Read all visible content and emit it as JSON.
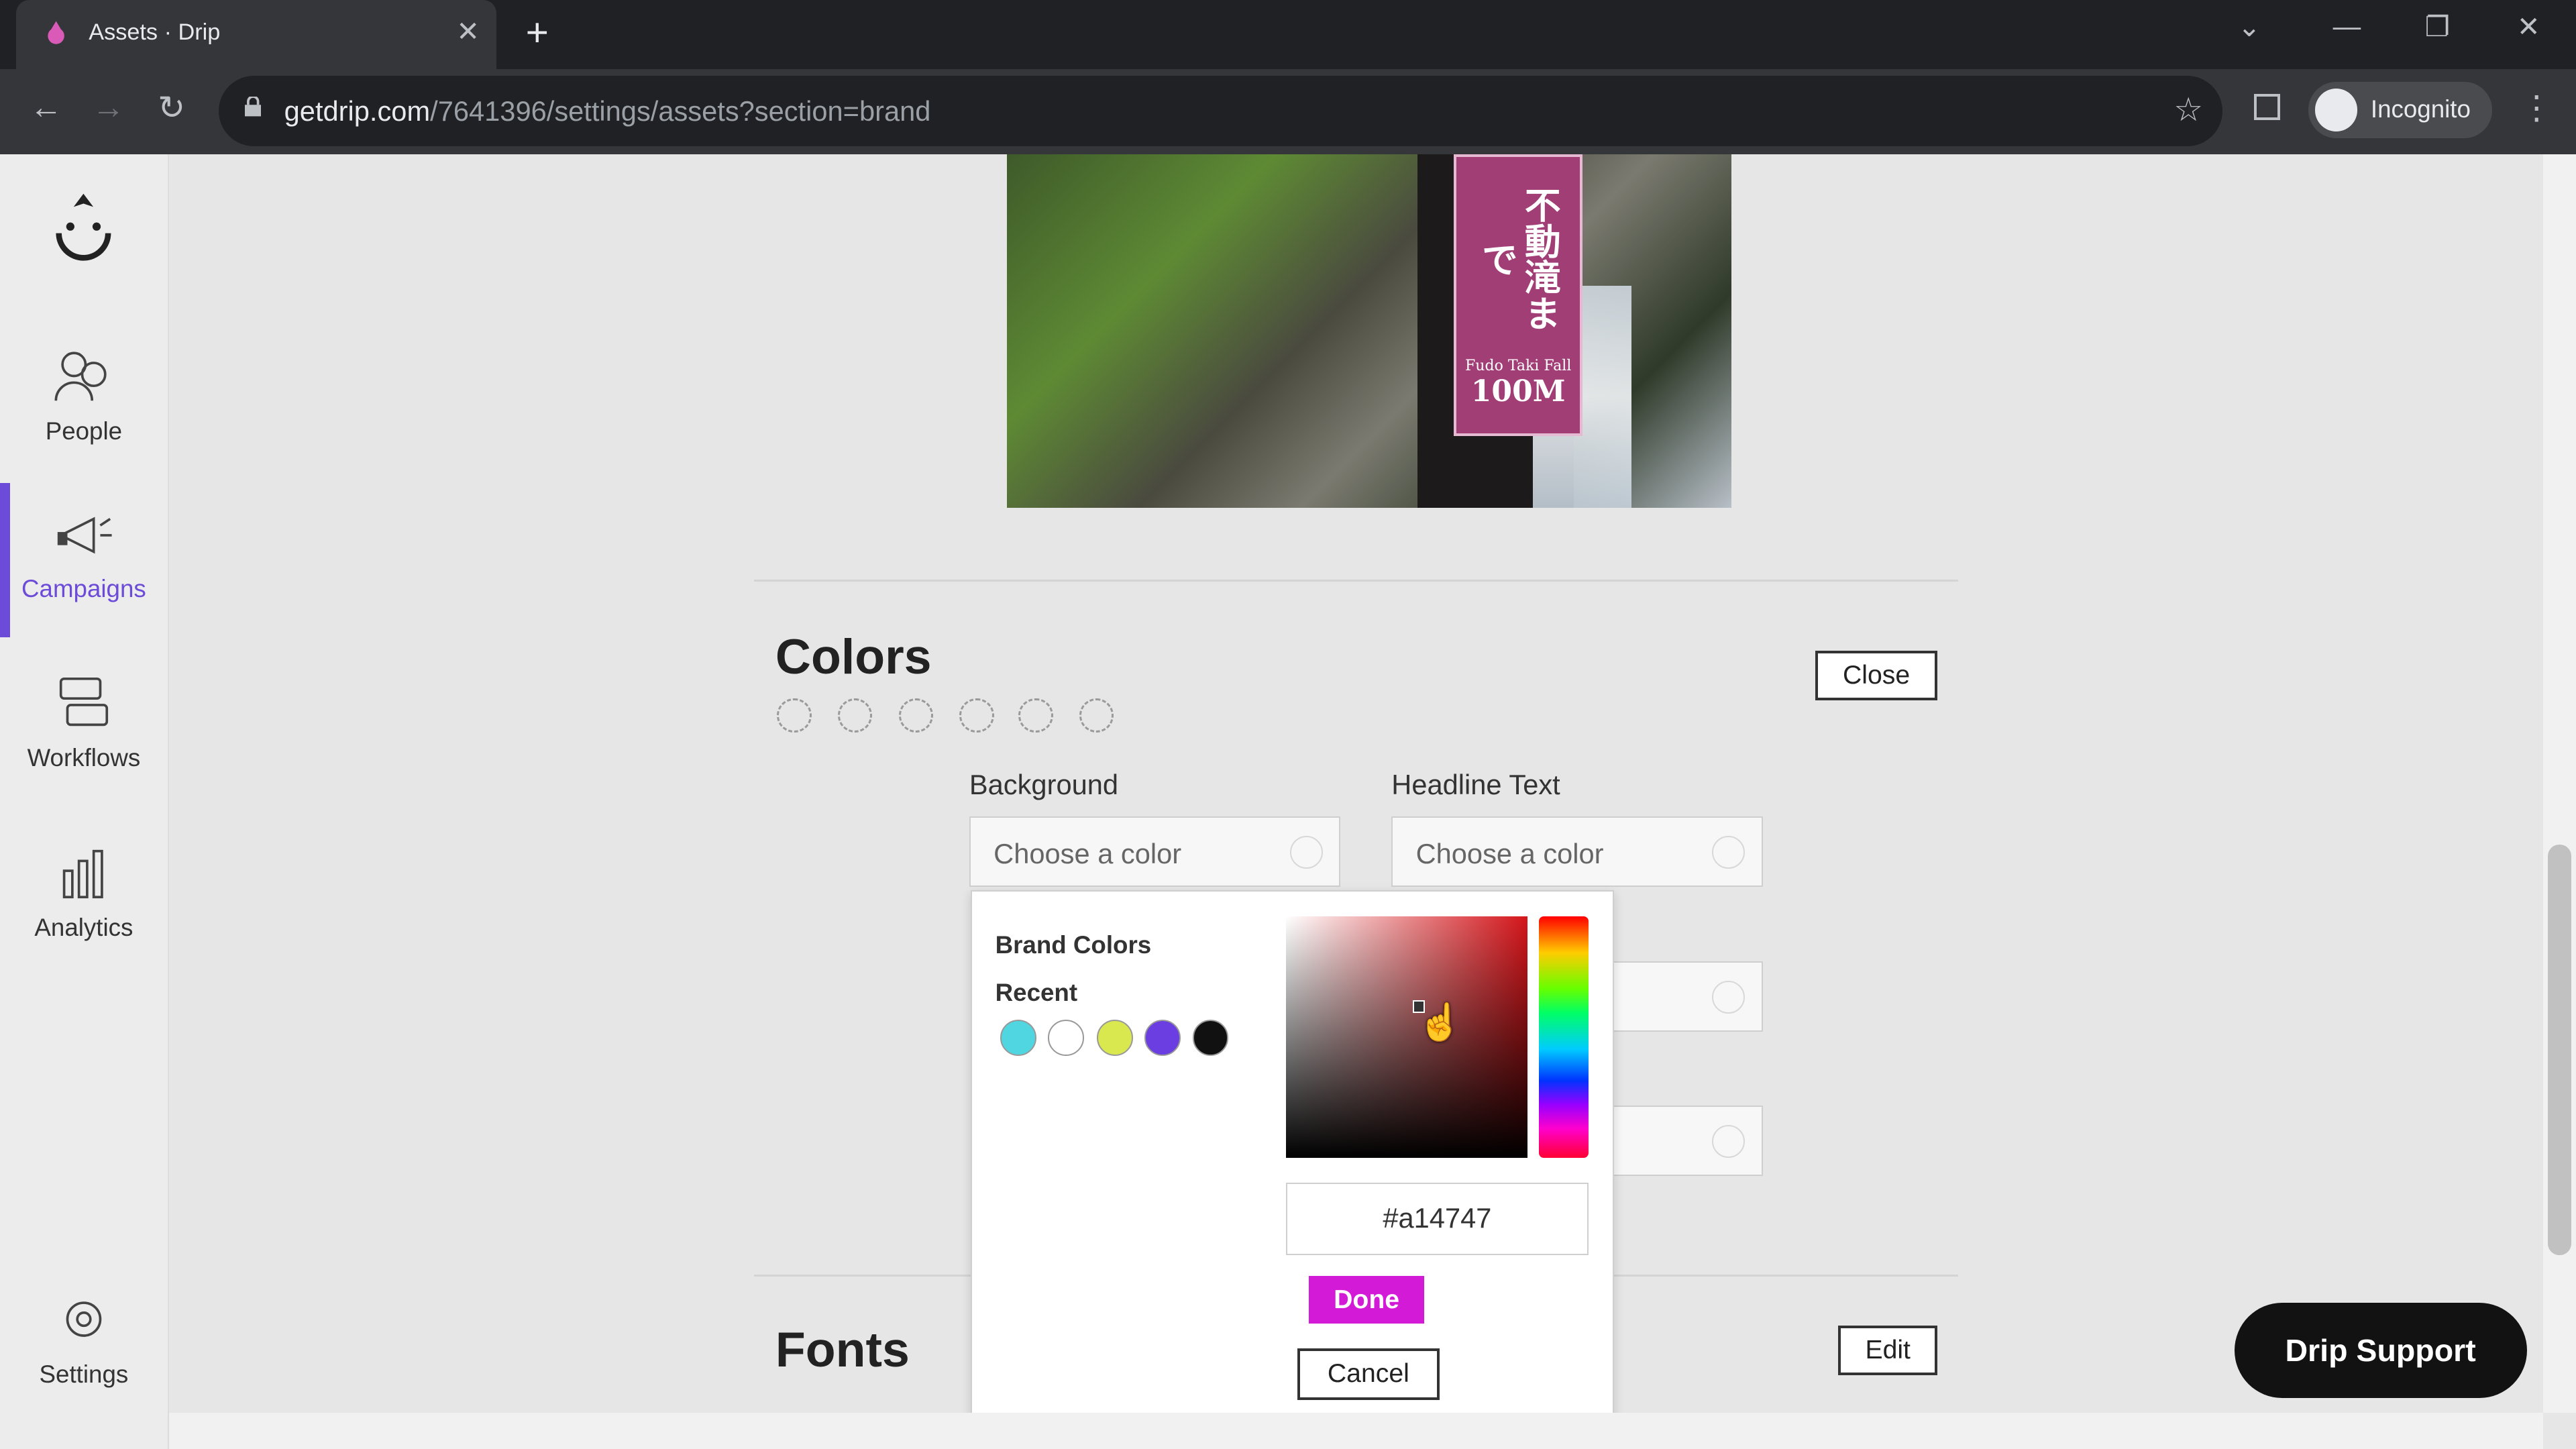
{
  "browser": {
    "tab_title": "Assets · Drip",
    "url_host": "getdrip.com",
    "url_path": "/7641396/settings/assets?section=brand",
    "profile_label": "Incognito"
  },
  "sidebar": {
    "items": [
      {
        "label": "People",
        "icon": "people-icon"
      },
      {
        "label": "Campaigns",
        "icon": "megaphone-icon"
      },
      {
        "label": "Workflows",
        "icon": "workflow-icon"
      },
      {
        "label": "Analytics",
        "icon": "bar-chart-icon"
      },
      {
        "label": "Settings",
        "icon": "gear-icon"
      }
    ],
    "active": "Campaigns",
    "accent": "#6c4bd8"
  },
  "photo": {
    "sign_jp": "不動滝まで",
    "sign_en": "Fudo Taki Fall",
    "sign_distance": "100M"
  },
  "colors_section": {
    "title": "Colors",
    "close_label": "Close",
    "background_label": "Background",
    "headline_label": "Headline Text",
    "placeholder": "Choose a color"
  },
  "picker": {
    "brand_colors_label": "Brand Colors",
    "recent_label": "Recent",
    "recent_colors": [
      "#4fd6e0",
      "#ffffff",
      "#d9e84f",
      "#6a3ee0",
      "#111111"
    ],
    "hex_value": "#a14747",
    "done_label": "Done",
    "cancel_label": "Cancel",
    "done_color": "#d31ad6"
  },
  "fonts_section": {
    "title": "Fonts",
    "edit_label": "Edit"
  },
  "support_button": "Drip Support"
}
